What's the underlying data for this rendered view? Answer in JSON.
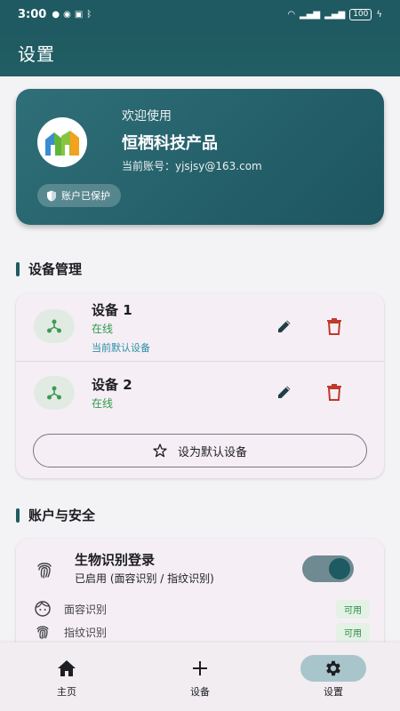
{
  "status_bar": {
    "time": "3:00",
    "battery": "100"
  },
  "app_bar": {
    "title": "设置"
  },
  "welcome": {
    "greeting": "欢迎使用",
    "product": "恒栖科技产品",
    "account_line": "当前账号：yjsjsy@163.com",
    "protected_label": "账户已保护"
  },
  "device_section": {
    "title": "设备管理"
  },
  "devices": [
    {
      "name": "设备 1",
      "status": "在线",
      "default_label": "当前默认设备"
    },
    {
      "name": "设备 2",
      "status": "在线"
    }
  ],
  "set_default_label": "设为默认设备",
  "security_section": {
    "title": "账户与安全"
  },
  "biometric": {
    "title": "生物识别登录",
    "subtitle": "已启用 (面容识别 / 指纹识别)",
    "enabled": true,
    "methods": [
      {
        "label": "面容识别",
        "badge": "可用",
        "icon": "face-icon"
      },
      {
        "label": "指纹识别",
        "badge": "可用",
        "icon": "fingerprint-icon"
      }
    ]
  },
  "bottom_nav": [
    {
      "label": "主页",
      "icon": "home-icon",
      "active": false
    },
    {
      "label": "设备",
      "icon": "plus-icon",
      "active": false
    },
    {
      "label": "设置",
      "icon": "gear-icon",
      "active": true
    }
  ],
  "colors": {
    "primary": "#1f5a62",
    "online": "#2e9a4b",
    "delete": "#c0392b",
    "accent_badge": "#2e8a45"
  }
}
